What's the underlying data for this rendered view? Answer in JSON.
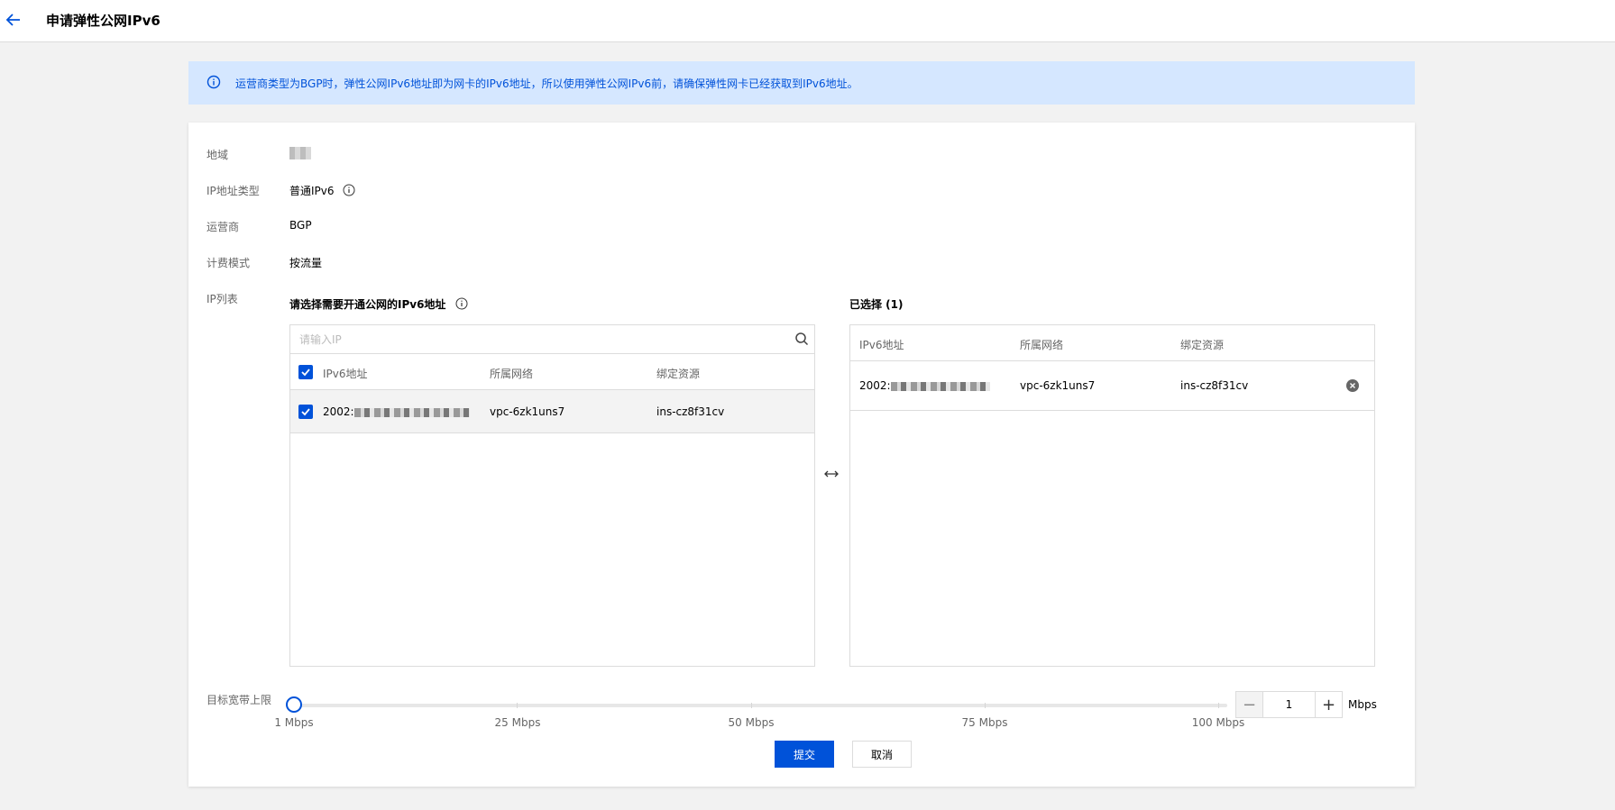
{
  "header": {
    "title": "申请弹性公网IPv6",
    "back_icon": "arrow-left-icon"
  },
  "notice": {
    "text": "运营商类型为BGP时，弹性公网IPv6地址即为网卡的IPv6地址，所以使用弹性公网IPv6前，请确保弹性网卡已经获取到IPv6地址。",
    "color": "#0052d9"
  },
  "form": {
    "region": {
      "label": "地域"
    },
    "ip_type": {
      "label": "IP地址类型",
      "value": "普通IPv6"
    },
    "isp": {
      "label": "运营商",
      "value": "BGP"
    },
    "billing": {
      "label": "计费模式",
      "value": "按流量"
    },
    "ip_list": {
      "label": "IP列表"
    },
    "bandwidth": {
      "label": "目标宽带上限"
    }
  },
  "transfer": {
    "left": {
      "title": "请选择需要开通公网的IPv6地址",
      "search_placeholder": "请输入IP",
      "columns": [
        "IPv6地址",
        "所属网络",
        "绑定资源"
      ],
      "rows": [
        {
          "ip": "2002:",
          "vpc": "vpc-6zk1uns7",
          "resource": "ins-cz8f31cv",
          "checked": true
        }
      ]
    },
    "right": {
      "title": "已选择 (1)",
      "columns": [
        "IPv6地址",
        "所属网络",
        "绑定资源"
      ],
      "rows": [
        {
          "ip": "2002:",
          "vpc": "vpc-6zk1uns7",
          "resource": "ins-cz8f31cv"
        }
      ]
    }
  },
  "slider": {
    "marks": [
      "1 Mbps",
      "25 Mbps",
      "50 Mbps",
      "75 Mbps",
      "100 Mbps"
    ],
    "value": 1,
    "min": 1,
    "max": 100,
    "unit": "Mbps"
  },
  "stepper": {
    "minus": "−",
    "plus": "+",
    "value": "1"
  },
  "actions": {
    "submit": "提交",
    "cancel": "取消"
  },
  "colors": {
    "accent": "#0052d9",
    "notice_bg": "#d5e7ff"
  }
}
